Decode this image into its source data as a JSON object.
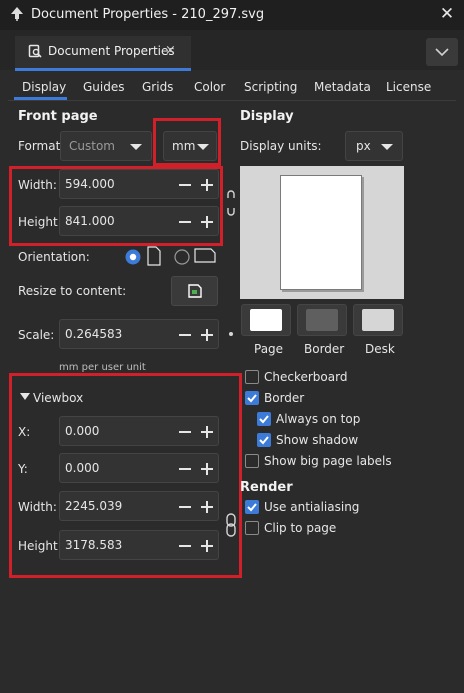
{
  "window": {
    "title": "Document Properties - 210_297.svg",
    "close_glyph": "✕"
  },
  "dock": {
    "tab_label": "Document Properties",
    "tab_close": "×"
  },
  "tabs": [
    "Display",
    "Guides",
    "Grids",
    "Color",
    "Scripting",
    "Metadata",
    "License"
  ],
  "front_page": {
    "heading": "Front page",
    "format_label": "Format:",
    "format_value": "Custom",
    "units_value": "mm",
    "width_label": "Width:",
    "width_value": "594.000",
    "height_label": "Height:",
    "height_value": "841.000",
    "orientation_label": "Orientation:",
    "resize_label": "Resize to content:",
    "scale_label": "Scale:",
    "scale_value": "0.264583",
    "scale_units": "mm per user unit"
  },
  "viewbox": {
    "heading": "Viewbox",
    "x_label": "X:",
    "x_value": "0.000",
    "y_label": "Y:",
    "y_value": "0.000",
    "width_label": "Width:",
    "width_value": "2245.039",
    "height_label": "Height:",
    "height_value": "3178.583"
  },
  "display": {
    "heading": "Display",
    "units_label": "Display units:",
    "units_value": "px",
    "swatches": [
      {
        "label": "Page",
        "color": "#ffffff"
      },
      {
        "label": "Border",
        "color": "#5f5f5f"
      },
      {
        "label": "Desk",
        "color": "#d6d6d6"
      }
    ],
    "options": [
      {
        "label": "Checkerboard",
        "checked": false
      },
      {
        "label": "Border",
        "checked": true
      },
      {
        "label": "Always on top",
        "checked": true
      },
      {
        "label": "Show shadow",
        "checked": true
      },
      {
        "label": "Show big page labels",
        "checked": false
      }
    ]
  },
  "render": {
    "heading": "Render",
    "options": [
      {
        "label": "Use antialiasing",
        "checked": true
      },
      {
        "label": "Clip to page",
        "checked": false
      }
    ]
  },
  "colors": {
    "accent": "#3d7bd8",
    "highlight_box": "#d2202a",
    "background": "#2b2b2b"
  }
}
